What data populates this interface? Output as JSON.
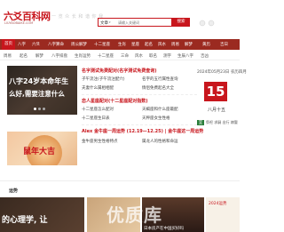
{
  "header": {
    "logo": "六爻百科网",
    "logo_sub": "LIUYAOBAIKE.COM",
    "slogan": "一 览 众 长   和 谐 你 我",
    "search_category": "文章",
    "search_placeholder": "请输入关键词",
    "search_button": "搜索"
  },
  "nav": {
    "items": [
      "首页",
      "八字",
      "六爻",
      "八字算命",
      "周公解梦",
      "十二星座",
      "生肖",
      "星座",
      "起名",
      "风水",
      "周易",
      "解梦",
      "黄历",
      "吉日"
    ]
  },
  "subnav": {
    "items": [
      "周易",
      "起名",
      "解梦",
      "八字排盘",
      "生肖运势",
      "十二星座",
      "三命",
      "风水",
      "取名",
      "测字",
      "生辰八字",
      "吉凶"
    ]
  },
  "banner": {
    "line1": "八字24岁本命年生",
    "line2": "么好,需要注意什么"
  },
  "ad2": {
    "text": "鼠年大吉"
  },
  "middle": {
    "titles": [
      "名字测试免费配对(名字测试免费查询)",
      "恋人星座配对(十二星座配对指数)",
      "Alex 金牛座一周运势 (12.19—12.25) | 金牛座这一周运势"
    ],
    "links": [
      "子午流注(子午流注配穴)",
      "名字的五行属性查询",
      "夫妻什么属相相配",
      "情侣免费起名大全",
      "十二星座怎么配对",
      "天蝎座和什么座最配",
      "十二星座生日表",
      "天秤座女生性格",
      "金牛座男生性格特点",
      "属龙人的性格和命运"
    ]
  },
  "calendar": {
    "date_head": "2024年05月23日   农历四月",
    "day": "15",
    "lunar": "八月十五",
    "yi_label": "宜",
    "ji_label": "忌",
    "yi_text": "祭祀 求嗣 出行 嫁娶",
    "ji_text": "开市 动土 安葬"
  },
  "section": {
    "label": "运势"
  },
  "cards": {
    "card1_text": "的心理学, 让",
    "card3_caption": "日本房产在中国买好吗",
    "card4_caption": "2024运势",
    "watermark": "优质库"
  }
}
